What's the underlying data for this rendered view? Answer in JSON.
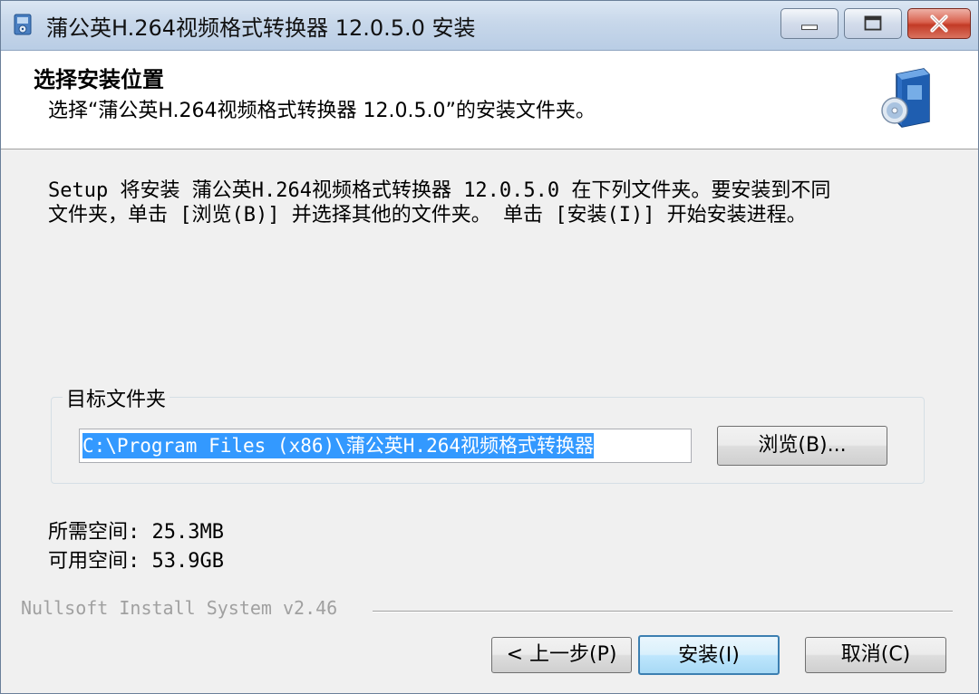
{
  "window": {
    "title": "蒲公英H.264视频格式转换器 12.0.5.0 安装"
  },
  "header": {
    "title": "选择安装位置",
    "subtitle": "选择“蒲公英H.264视频格式转换器 12.0.5.0”的安装文件夹。"
  },
  "body": {
    "intro_line1": "Setup 将安装 蒲公英H.264视频格式转换器 12.0.5.0 在下列文件夹。要安装到不同",
    "intro_line2": "文件夹，单击 [浏览(B)] 并选择其他的文件夹。 单击 [安装(I)] 开始安装进程。"
  },
  "destination": {
    "group_label": "目标文件夹",
    "path_value": "C:\\Program Files (x86)\\蒲公英H.264视频格式转换器",
    "browse_label": "浏览(B)..."
  },
  "space": {
    "required_text": "所需空间: 25.3MB",
    "available_text": "可用空间: 53.9GB"
  },
  "footer": {
    "branding": "Nullsoft Install System v2.46",
    "back_label": "< 上一步(P)",
    "install_label": "安装(I)",
    "cancel_label": "取消(C)"
  },
  "icons": {
    "app": "installer-app-icon",
    "header": "software-box-icon",
    "minimize": "minimize-icon",
    "maximize": "maximize-icon",
    "close": "close-icon"
  },
  "colors": {
    "selection": "#3399ff",
    "default_button_border": "#3c7fb1",
    "close_button": "#c33a26"
  }
}
